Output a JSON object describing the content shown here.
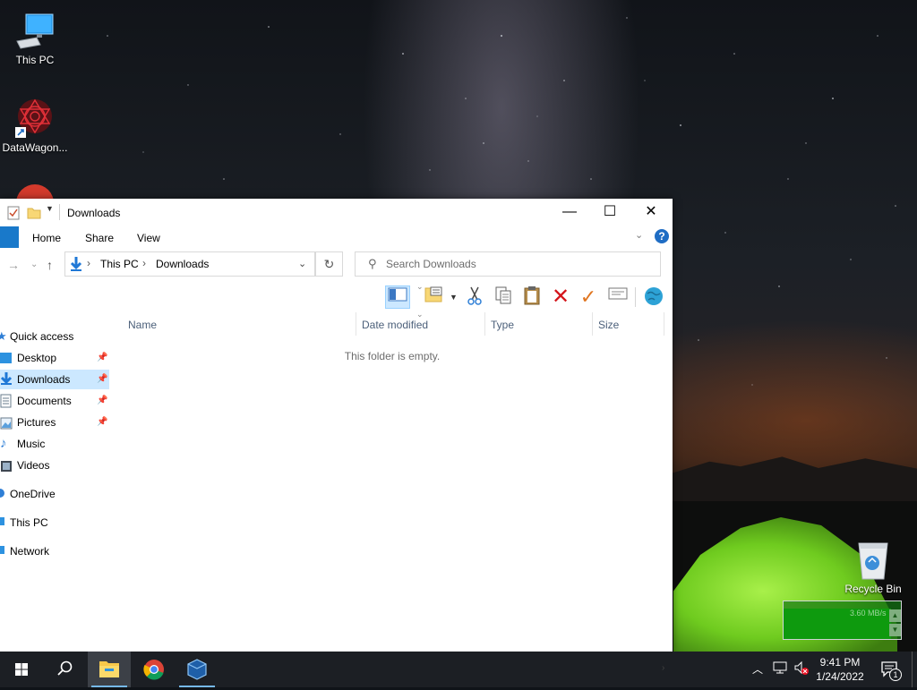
{
  "desktop": {
    "icons": [
      {
        "label": "This PC"
      },
      {
        "label": "DataWagon..."
      },
      {
        "label": "Recycle Bin"
      }
    ]
  },
  "explorer": {
    "title": "Downloads",
    "ribbon_tabs": [
      "Home",
      "Share",
      "View"
    ],
    "window_buttons": {
      "minimize": "—",
      "maximize": "☐",
      "close": "✕"
    },
    "address": {
      "crumbs": [
        "This PC",
        "Downloads"
      ]
    },
    "search": {
      "placeholder": "Search Downloads"
    },
    "nav_pane": [
      {
        "label": "Quick access",
        "pinned": false
      },
      {
        "label": "Desktop",
        "pinned": true
      },
      {
        "label": "Downloads",
        "pinned": true,
        "selected": true
      },
      {
        "label": "Documents",
        "pinned": true
      },
      {
        "label": "Pictures",
        "pinned": true
      },
      {
        "label": "Music",
        "pinned": false
      },
      {
        "label": "Videos",
        "pinned": false
      },
      {
        "label": "OneDrive",
        "pinned": false
      },
      {
        "label": "This PC",
        "pinned": false
      },
      {
        "label": "Network",
        "pinned": false
      }
    ],
    "columns": [
      "Name",
      "Date modified",
      "Type",
      "Size"
    ],
    "empty_message": "This folder is empty."
  },
  "net_widget": {
    "rate": "3.60 MB/s",
    "up": "▲",
    "down": "▼"
  },
  "taskbar": {
    "clock": {
      "time": "9:41 PM",
      "date": "1/24/2022"
    },
    "notification_count": "1"
  },
  "colors": {
    "accent": "#1979ca",
    "selection": "#cce8ff",
    "taskbar": "#1c1f24"
  }
}
